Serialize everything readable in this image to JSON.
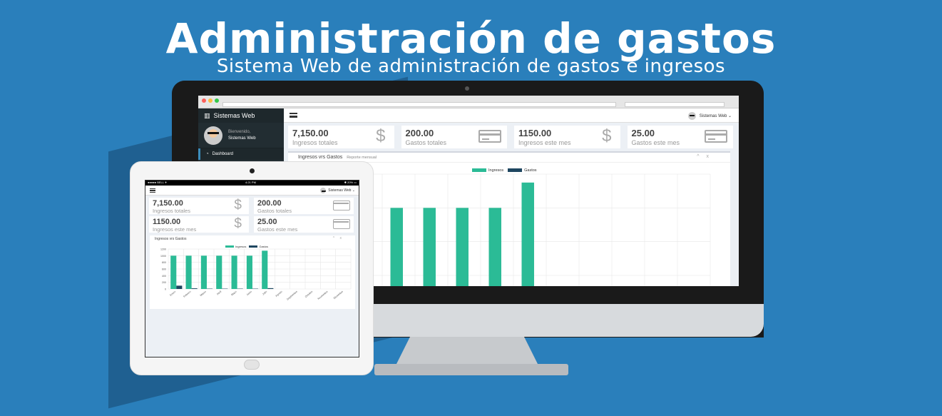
{
  "hero": {
    "title": "Administración de gastos",
    "subtitle": "Sistema Web de administración de gastos e ingresos"
  },
  "app": {
    "brand": "Sistemas Web",
    "welcome": "Bienvenido,",
    "user_name": "Sistemas Web",
    "top_user": "Sistemas Web ⌄",
    "nav": [
      {
        "label": "Dashboard",
        "icon": "dashboard-icon"
      }
    ]
  },
  "stats": [
    {
      "value": "7,150.00",
      "label": "Ingresos totales",
      "icon": "dollar-icon"
    },
    {
      "value": "200.00",
      "label": "Gastos totales",
      "icon": "credit-card-icon"
    },
    {
      "value": "1150.00",
      "label": "Ingresos este mes",
      "icon": "dollar-icon"
    },
    {
      "value": "25.00",
      "label": "Gastos este mes",
      "icon": "credit-card-icon"
    }
  ],
  "chart_box": {
    "title": "Ingresos vrs Gastos",
    "subtitle": "Reporte mensual",
    "tools": "^ x"
  },
  "tablet_status": {
    "carrier": "●●●●● BELL ✈",
    "time": "4:21 PM",
    "battery": "✱ 20% ▭"
  },
  "colors": {
    "background": "#2a7fbb",
    "ingresos": "#2bbb96",
    "gastos": "#1e4660",
    "sidebar": "#222d32"
  },
  "chart_data": {
    "type": "bar",
    "title": "Ingresos vrs Gastos",
    "categories": [
      "Enero",
      "Febrero",
      "Marzo",
      "Abril",
      "Mayo",
      "Junio",
      "Julio",
      "Agosto",
      "Septiembre",
      "Octubre",
      "Noviembre",
      "Diciembre"
    ],
    "series": [
      {
        "name": "Ingresos",
        "values": [
          1000,
          1000,
          1000,
          1000,
          1000,
          1000,
          1150,
          0,
          0,
          0,
          0,
          0
        ]
      },
      {
        "name": "Gastos",
        "values": [
          100,
          20,
          10,
          10,
          10,
          10,
          25,
          0,
          0,
          0,
          0,
          0
        ]
      }
    ],
    "yticks": [
      0,
      200,
      400,
      600,
      800,
      1000,
      1200
    ],
    "ylim": [
      0,
      1200
    ],
    "grid": true,
    "legend": "top-center"
  }
}
